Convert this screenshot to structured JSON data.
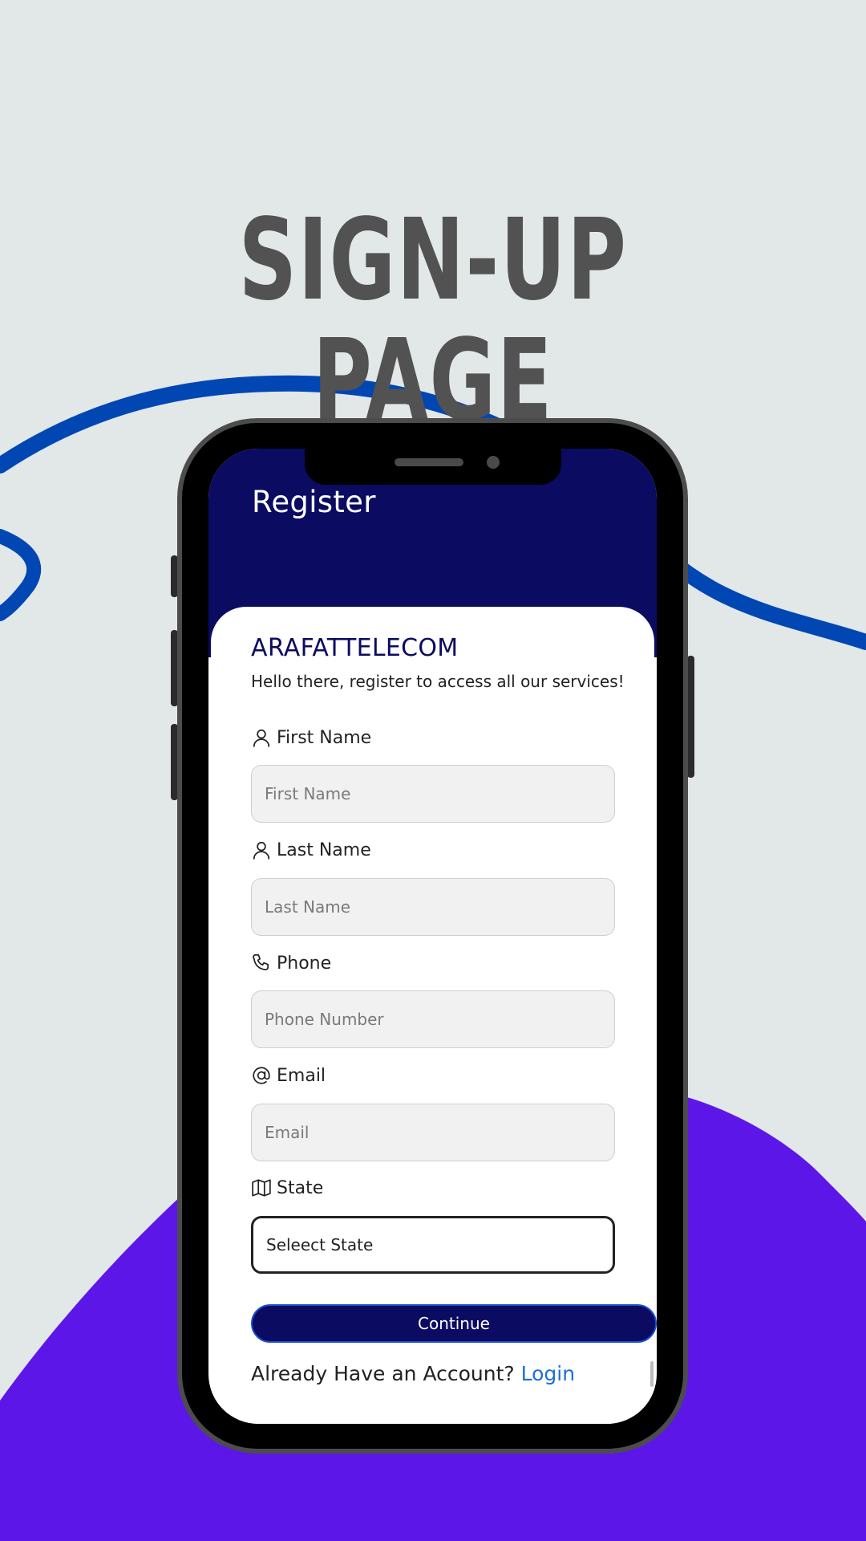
{
  "headline": "SIGN-UP PAGE",
  "colors": {
    "background": "#e2e7e8",
    "app_primary": "#0b0b62",
    "swoosh_blue": "#0047b3",
    "purple_blob": "#5c17e8",
    "link": "#1e6fd9"
  },
  "app": {
    "title": "Register",
    "brand": "ARAFATTELECOM",
    "subtitle": "Hello there, register to access all our services!",
    "fields": [
      {
        "label": "First Name",
        "icon": "user-icon",
        "placeholder": "First Name",
        "value": ""
      },
      {
        "label": "Last Name",
        "icon": "user-icon",
        "placeholder": "Last Name",
        "value": ""
      },
      {
        "label": "Phone",
        "icon": "phone-icon",
        "placeholder": "Phone Number",
        "value": ""
      },
      {
        "label": "Email",
        "icon": "at-icon",
        "placeholder": "Email",
        "value": ""
      }
    ],
    "state": {
      "label": "State",
      "icon": "map-icon",
      "selected": "Seleect State"
    },
    "continue_label": "Continue",
    "login_prompt": "Already Have an Account?",
    "login_link": "Login"
  }
}
